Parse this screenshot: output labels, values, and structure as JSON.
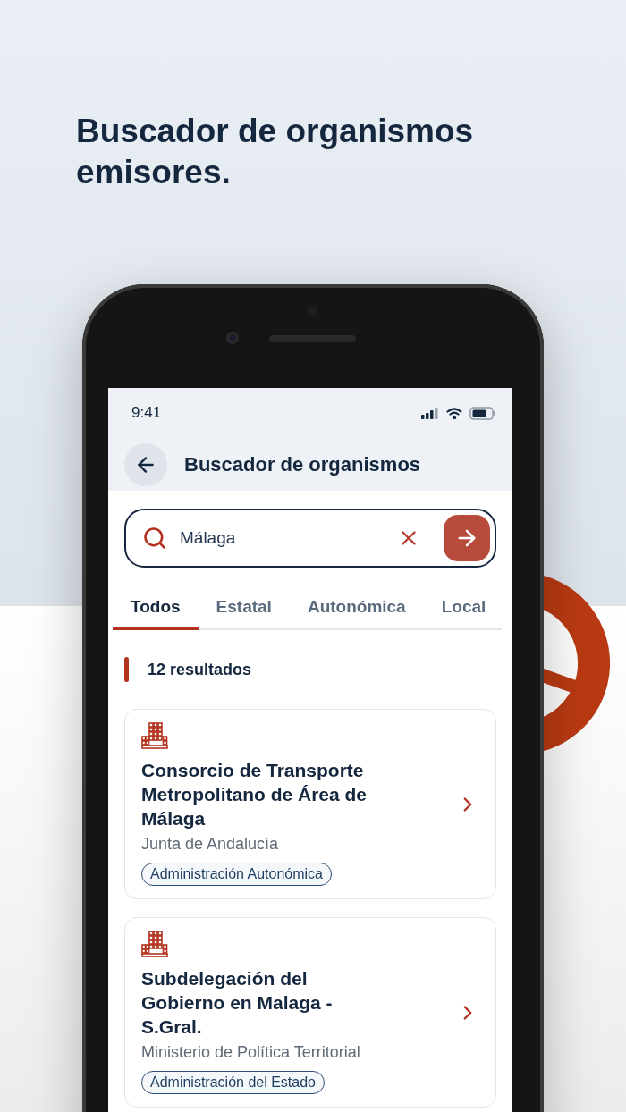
{
  "headline": "Buscador de organismos emisores.",
  "status_bar": {
    "time": "9:41"
  },
  "header": {
    "title": "Buscador de organismos"
  },
  "search": {
    "value": "Málaga"
  },
  "tabs": [
    {
      "label": "Todos",
      "selected": true
    },
    {
      "label": "Estatal",
      "selected": false
    },
    {
      "label": "Autonómica",
      "selected": false
    },
    {
      "label": "Local",
      "selected": false
    }
  ],
  "results": {
    "count": "12 resultados"
  },
  "cards": [
    {
      "title": "Consorcio de Transporte Metropolitano de Área de Málaga",
      "subtitle": "Junta de Andalucía",
      "tag": "Administración Autonómica"
    },
    {
      "title": "Subdelegación del Gobierno en Malaga - S.Gral.",
      "subtitle": "Ministerio de Política Territorial",
      "tag": "Administración del Estado"
    }
  ]
}
